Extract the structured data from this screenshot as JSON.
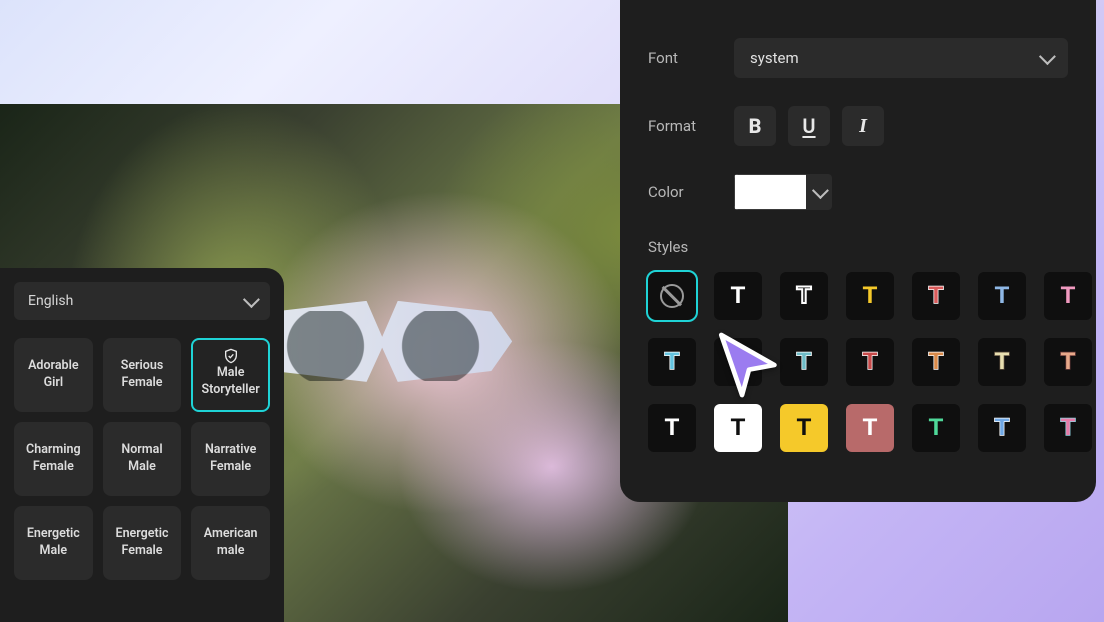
{
  "voice_panel": {
    "language": "English",
    "selected_index": 2,
    "voices": [
      "Adorable Girl",
      "Serious Female",
      "Male Storyteller",
      "Charming Female",
      "Normal Male",
      "Narrative Female",
      "Energetic Male",
      "Energetic Female",
      "American male"
    ]
  },
  "text_panel": {
    "font_label": "Font",
    "font_value": "system",
    "format_label": "Format",
    "format_buttons": {
      "bold": "B",
      "underline": "U",
      "italic": "I"
    },
    "color_label": "Color",
    "color_value": "#FFFFFF",
    "styles_label": "Styles",
    "selected_style": 0,
    "styles": [
      {
        "id": "none",
        "bg": "#0f0f0f",
        "fg": "#9a9a9a",
        "glyph": "⊘"
      },
      {
        "id": "white",
        "bg": "#0f0f0f",
        "fg": "#ffffff",
        "glyph": "T"
      },
      {
        "id": "outline",
        "bg": "#0f0f0f",
        "fg": "#ffffff",
        "glyph": "T",
        "outline": true
      },
      {
        "id": "yellow",
        "bg": "#0f0f0f",
        "fg": "#f5c92a",
        "glyph": "T"
      },
      {
        "id": "redout",
        "bg": "#0f0f0f",
        "fg": "#d95b5b",
        "glyph": "T",
        "stroke": "#ffffff"
      },
      {
        "id": "lblue",
        "bg": "#0f0f0f",
        "fg": "#8fb8e6",
        "glyph": "T"
      },
      {
        "id": "pink",
        "bg": "#0f0f0f",
        "fg": "#f19ac0",
        "glyph": "T"
      },
      {
        "id": "cyan2",
        "bg": "#0f0f0f",
        "fg": "#64c4e0",
        "glyph": "T",
        "stroke": "#ffffff"
      },
      {
        "id": "blank",
        "bg": "#0f0f0f",
        "fg": "#0f0f0f",
        "glyph": ""
      },
      {
        "id": "teal",
        "bg": "#0f0f0f",
        "fg": "#6fbcc7",
        "glyph": "T",
        "stroke": "#ffffff"
      },
      {
        "id": "red2",
        "bg": "#0f0f0f",
        "fg": "#c84a4a",
        "glyph": "T",
        "stroke": "#ffffff"
      },
      {
        "id": "orange",
        "bg": "#0f0f0f",
        "fg": "#d98a4a",
        "glyph": "T",
        "stroke": "#ffffff"
      },
      {
        "id": "cream",
        "bg": "#0f0f0f",
        "fg": "#e8dfb0",
        "glyph": "T",
        "stroke": "#5a4a3a"
      },
      {
        "id": "peach",
        "bg": "#0f0f0f",
        "fg": "#e8a98a",
        "glyph": "T",
        "stroke": "#6a3a3a"
      },
      {
        "id": "blk-w",
        "bg": "#0f0f0f",
        "fg": "#ffffff",
        "glyph": "T"
      },
      {
        "id": "w-blk",
        "bg": "#ffffff",
        "fg": "#0f0f0f",
        "glyph": "T"
      },
      {
        "id": "y-blk",
        "bg": "#f5c92a",
        "fg": "#0f0f0f",
        "glyph": "T"
      },
      {
        "id": "rose-w",
        "bg": "#b86a6a",
        "fg": "#ffffff",
        "glyph": "T"
      },
      {
        "id": "blk-grn",
        "bg": "#0f0f0f",
        "fg": "#4fd99a",
        "glyph": "T"
      },
      {
        "id": "blk-bw",
        "bg": "#0f0f0f",
        "fg": "#6fa8e6",
        "glyph": "T",
        "stroke": "#ffffff"
      },
      {
        "id": "blk-pk",
        "bg": "#0f0f0f",
        "fg": "#e87aa8",
        "glyph": "T",
        "stroke": "#8fd4e0"
      }
    ]
  }
}
